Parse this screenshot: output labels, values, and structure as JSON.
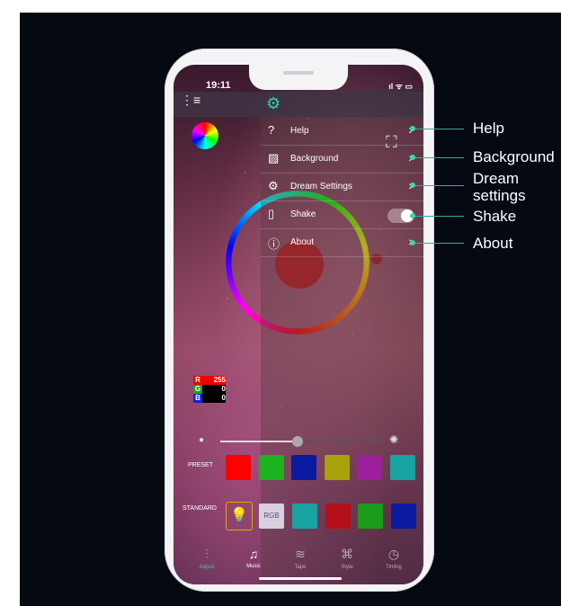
{
  "status_bar": {
    "time": "19:11",
    "indicators": "ıl ᯤ ▭"
  },
  "menu": {
    "gear_icon": "gear-icon",
    "items": [
      {
        "icon": "help-icon",
        "label": "Help"
      },
      {
        "icon": "image-icon",
        "label": "Background"
      },
      {
        "icon": "gear-icon",
        "label": "Dream Settings"
      },
      {
        "icon": "shake-icon",
        "label": "Shake",
        "toggle_on": true
      },
      {
        "icon": "info-icon",
        "label": "About"
      }
    ]
  },
  "rgb_readout": {
    "r_key": "R",
    "r": "255",
    "g_key": "G",
    "g": "0",
    "b_key": "B",
    "b": "0"
  },
  "brightness": {
    "level": 0.47
  },
  "preset": {
    "label": "PRESET",
    "colors": [
      "#ff0000",
      "#1db31d",
      "#0a1aa0",
      "#a8a20b",
      "#9c1f9c",
      "#1aa3a3"
    ]
  },
  "standard": {
    "label": "STANDARD",
    "rgb_label": "RGB",
    "colors": [
      "#1aa3a3",
      "#b3101a",
      "#1a9c1a",
      "#0a1aa0"
    ]
  },
  "tabs": [
    {
      "label": "Adjust",
      "icon": "sliders-icon",
      "active": true
    },
    {
      "label": "Music",
      "icon": "music-icon"
    },
    {
      "label": "Tape",
      "icon": "wave-icon"
    },
    {
      "label": "Style",
      "icon": "command-icon"
    },
    {
      "label": "Timing",
      "icon": "clock-icon"
    }
  ],
  "callouts": {
    "help": "Help",
    "background": "Background",
    "dream_settings_1": "Dream",
    "dream_settings_2": "settings",
    "shake": "Shake",
    "about": "About"
  },
  "colors": {
    "accent": "#27d3b0",
    "callout_line": "#3aa99a"
  }
}
